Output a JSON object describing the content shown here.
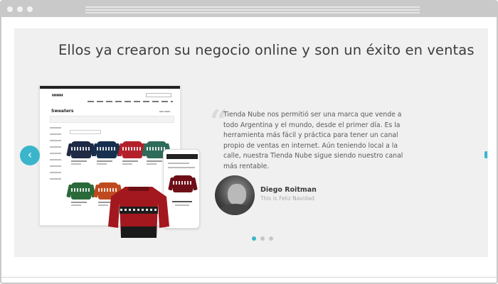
{
  "headline": "Ellos ya crearon su negocio online y son un éxito en ventas",
  "desktop_mock": {
    "title": "Sweaters"
  },
  "testimonial": {
    "quote": "Tienda Nube nos permitió ser una marca que vende a todo Argentina y el mundo, desde el primer día. Es la herramienta más fácil y práctica para tener un canal propio de ventas en internet. Aún teniendo local a la calle, nuestra Tienda Nube sigue siendo nuestro canal más rentable.",
    "author_name": "Diego Roitman",
    "author_company": "This is Feliz Navidad"
  },
  "carousel": {
    "prev_icon": "chevron-left-icon",
    "next_icon": "chevron-right-icon",
    "dots": 3,
    "active_dot": 0
  },
  "colors": {
    "accent": "#3bb5cc",
    "slide_bg": "#f0f0f0",
    "frame": "#c9c9c9"
  }
}
